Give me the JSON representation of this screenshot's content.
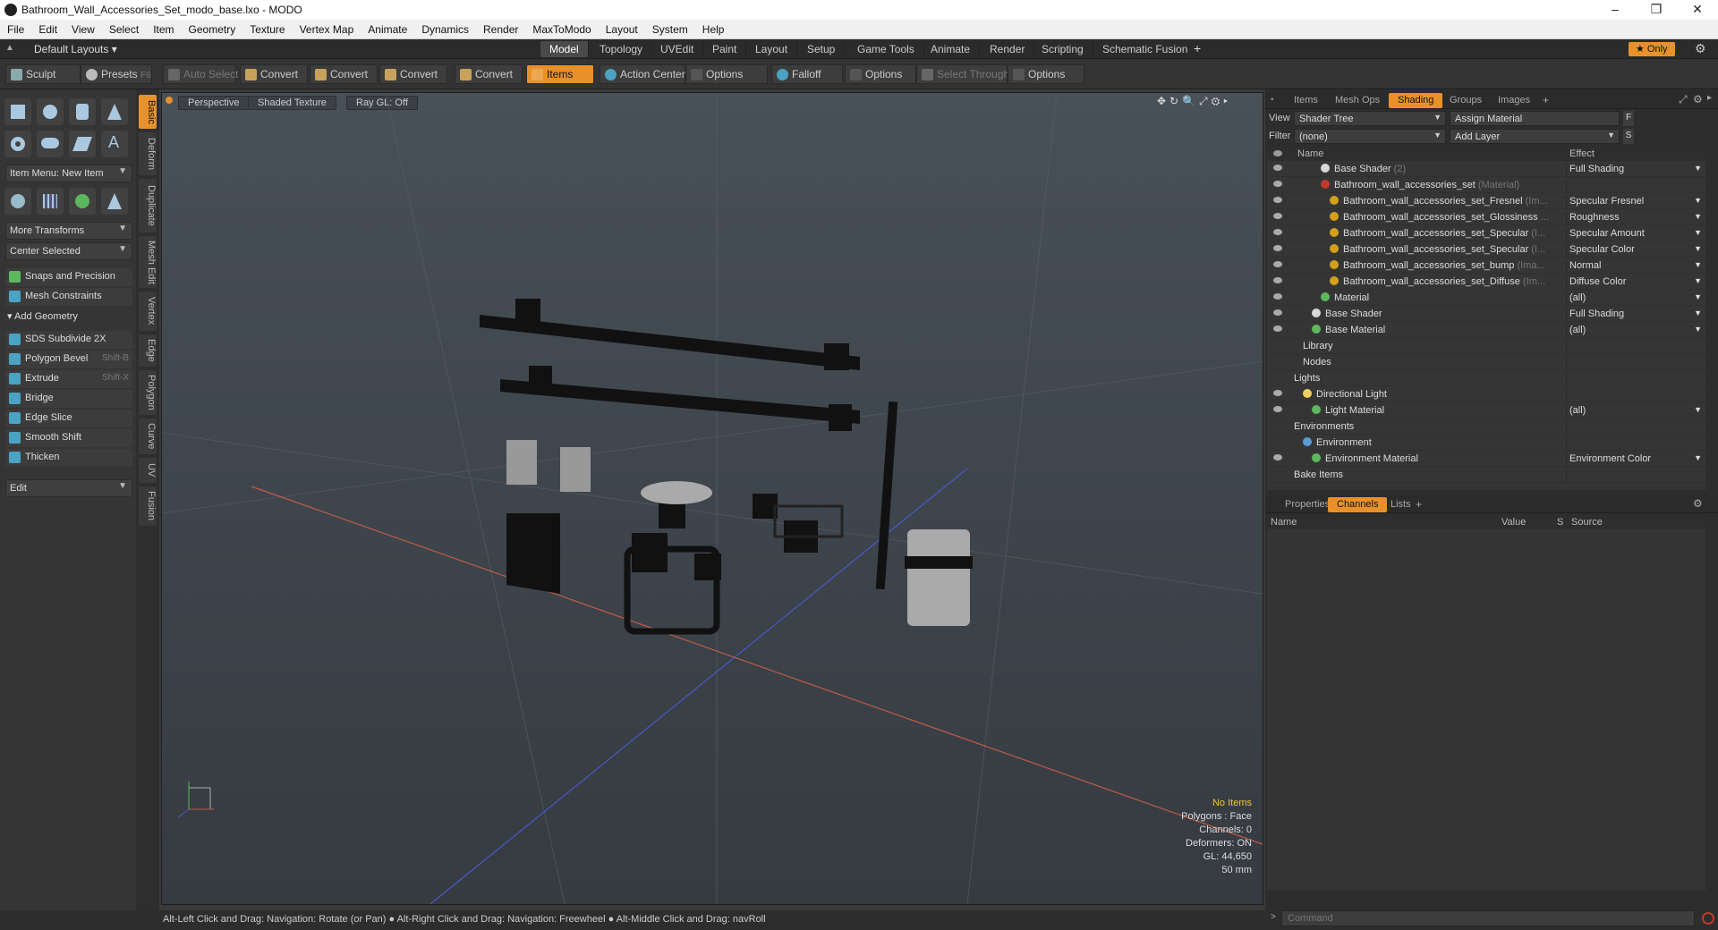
{
  "title": "Bathroom_Wall_Accessories_Set_modo_base.lxo - MODO",
  "window_controls": [
    "–",
    "❐",
    "✕"
  ],
  "menu": [
    "File",
    "Edit",
    "View",
    "Select",
    "Item",
    "Geometry",
    "Texture",
    "Vertex Map",
    "Animate",
    "Dynamics",
    "Render",
    "MaxToModo",
    "Layout",
    "System",
    "Help"
  ],
  "layout_selector": "Default Layouts ▾",
  "layout_tabs": [
    "Model",
    "Topology",
    "UVEdit",
    "Paint",
    "Layout",
    "Setup",
    "Game Tools",
    "Animate",
    "Render",
    "Scripting",
    "Schematic Fusion"
  ],
  "layout_plus": "+",
  "only_label": "★ Only",
  "toolbar": {
    "sculpt": "Sculpt",
    "presets": "Presets",
    "presets_key": "F6",
    "auto_select": "Auto Select",
    "convert": "Convert",
    "items": "Items",
    "action_center": "Action Center",
    "options": "Options",
    "falloff": "Falloff",
    "select_through": "Select Through"
  },
  "left": {
    "item_menu": "Item Menu: New Item",
    "more_transforms": "More Transforms",
    "center_selected": "Center Selected",
    "snaps": "Snaps and Precision",
    "mesh_constraints": "Mesh Constraints",
    "add_geometry": "Add Geometry",
    "tools": [
      {
        "label": "SDS Subdivide 2X",
        "key": ""
      },
      {
        "label": "Polygon Bevel",
        "key": "Shift-B"
      },
      {
        "label": "Extrude",
        "key": "Shift-X"
      },
      {
        "label": "Bridge",
        "key": ""
      },
      {
        "label": "Edge Slice",
        "key": ""
      },
      {
        "label": "Smooth Shift",
        "key": ""
      },
      {
        "label": "Thicken",
        "key": ""
      }
    ],
    "edit": "Edit"
  },
  "vtabs": [
    "Basic",
    "Deform",
    "Duplicate",
    "Mesh Edit",
    "Vertex",
    "Edge",
    "Polygon",
    "Curve",
    "UV",
    "Fusion"
  ],
  "viewport": {
    "perspective": "Perspective",
    "shading": "Shaded Texture",
    "raygl": "Ray GL: Off",
    "info": {
      "no_items": "No Items",
      "polygons": "Polygons : Face",
      "channels": "Channels: 0",
      "deformers": "Deformers: ON",
      "gl": "GL: 44,650",
      "scale": "50 mm"
    }
  },
  "status": "Alt-Left Click and Drag: Navigation: Rotate (or Pan) ● Alt-Right Click and Drag: Navigation: Freewheel ● Alt-Middle Click and Drag: navRoll",
  "right": {
    "tabs": [
      "Items",
      "Mesh Ops",
      "Shading",
      "Groups",
      "Images"
    ],
    "view_label": "View",
    "view_value": "Shader Tree",
    "assign_material": "Assign Material",
    "filter_label": "Filter",
    "filter_value": "(none)",
    "add_layer": "Add Layer",
    "col_name": "Name",
    "col_effect": "Effect",
    "tree": [
      {
        "indent": 4,
        "icon": "#d8d8d8",
        "name": "Base Shader",
        "sub": "(2)",
        "effect": "Full Shading",
        "eye": true
      },
      {
        "indent": 4,
        "icon": "#c0392b",
        "name": "Bathroom_wall_accessories_set",
        "sub": "(Material)",
        "effect": "",
        "eye": true
      },
      {
        "indent": 5,
        "icon": "#d4a017",
        "name": "Bathroom_wall_accessories_set_Fresnel",
        "sub": "(Im...",
        "effect": "Specular Fresnel",
        "eye": true
      },
      {
        "indent": 5,
        "icon": "#d4a017",
        "name": "Bathroom_wall_accessories_set_Glossiness",
        "sub": "...",
        "effect": "Roughness",
        "eye": true
      },
      {
        "indent": 5,
        "icon": "#d4a017",
        "name": "Bathroom_wall_accessories_set_Specular",
        "sub": "(I...",
        "effect": "Specular Amount",
        "eye": true
      },
      {
        "indent": 5,
        "icon": "#d4a017",
        "name": "Bathroom_wall_accessories_set_Specular",
        "sub": "(I...",
        "effect": "Specular Color",
        "eye": true
      },
      {
        "indent": 5,
        "icon": "#d4a017",
        "name": "Bathroom_wall_accessories_set_bump",
        "sub": "(Ima...",
        "effect": "Normal",
        "eye": true
      },
      {
        "indent": 5,
        "icon": "#d4a017",
        "name": "Bathroom_wall_accessories_set_Diffuse",
        "sub": "(Im...",
        "effect": "Diffuse Color",
        "eye": true
      },
      {
        "indent": 4,
        "icon": "#5cb85c",
        "name": "Material",
        "sub": "",
        "effect": "(all)",
        "eye": true
      },
      {
        "indent": 3,
        "icon": "#d8d8d8",
        "name": "Base Shader",
        "sub": "",
        "effect": "Full Shading",
        "eye": true
      },
      {
        "indent": 3,
        "icon": "#5cb85c",
        "name": "Base Material",
        "sub": "",
        "effect": "(all)",
        "eye": true
      },
      {
        "indent": 2,
        "icon": "",
        "name": "Library",
        "sub": "",
        "effect": "",
        "eye": false
      },
      {
        "indent": 2,
        "icon": "",
        "name": "Nodes",
        "sub": "",
        "effect": "",
        "eye": false
      },
      {
        "indent": 1,
        "icon": "",
        "name": "Lights",
        "sub": "",
        "effect": "",
        "eye": false
      },
      {
        "indent": 2,
        "icon": "#f0d060",
        "name": "Directional Light",
        "sub": "",
        "effect": "",
        "eye": true
      },
      {
        "indent": 3,
        "icon": "#5cb85c",
        "name": "Light Material",
        "sub": "",
        "effect": "(all)",
        "eye": true
      },
      {
        "indent": 1,
        "icon": "",
        "name": "Environments",
        "sub": "",
        "effect": "",
        "eye": false
      },
      {
        "indent": 2,
        "icon": "#5b9bd5",
        "name": "Environment",
        "sub": "",
        "effect": "",
        "eye": false
      },
      {
        "indent": 3,
        "icon": "#5cb85c",
        "name": "Environment Material",
        "sub": "",
        "effect": "Environment Color",
        "eye": true
      },
      {
        "indent": 1,
        "icon": "",
        "name": "Bake Items",
        "sub": "",
        "effect": "",
        "eye": false
      }
    ],
    "lower_tabs": [
      "Properties",
      "Channels",
      "Lists"
    ],
    "chan_cols": [
      "Name",
      "Value",
      "S",
      "Source"
    ],
    "command_placeholder": "Command"
  }
}
